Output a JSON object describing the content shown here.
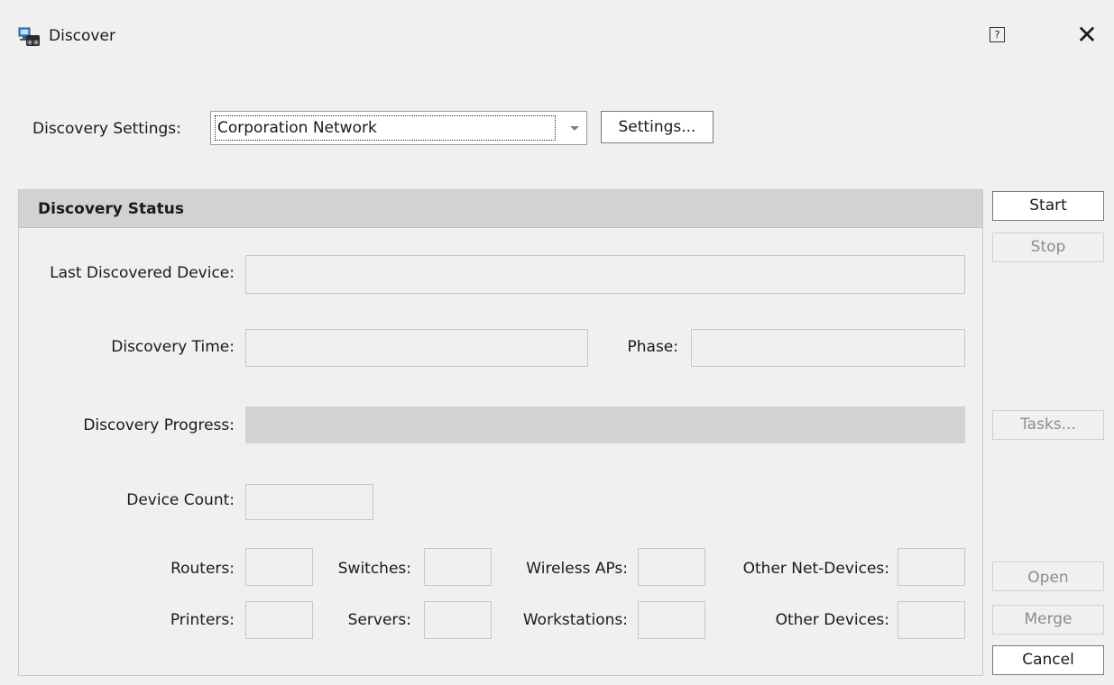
{
  "window": {
    "title": "Discover",
    "help_glyph": "?",
    "close_glyph": "✕",
    "icon": "network-discover-icon"
  },
  "settings": {
    "label": "Discovery Settings:",
    "selected": "Corporation Network",
    "settings_button": "Settings..."
  },
  "status": {
    "header": "Discovery Status",
    "last_device_label": "Last Discovered Device:",
    "last_device_value": "",
    "time_label": "Discovery Time:",
    "time_value": "",
    "phase_label": "Phase:",
    "phase_value": "",
    "progress_label": "Discovery Progress:",
    "progress_value": 0,
    "device_count_label": "Device Count:",
    "device_count_value": "",
    "routers_label": "Routers:",
    "switches_label": "Switches:",
    "wireless_label": "Wireless APs:",
    "other_net_label": "Other Net-Devices:",
    "printers_label": "Printers:",
    "servers_label": "Servers:",
    "workstations_label": "Workstations:",
    "other_devices_label": "Other Devices:"
  },
  "buttons": {
    "start": "Start",
    "stop": "Stop",
    "tasks": "Tasks...",
    "open": "Open",
    "merge": "Merge",
    "cancel": "Cancel"
  },
  "colors": {
    "background": "#f0f0f0",
    "header_bg": "#d2d2d2",
    "disabled_text": "#8c8c8c"
  }
}
